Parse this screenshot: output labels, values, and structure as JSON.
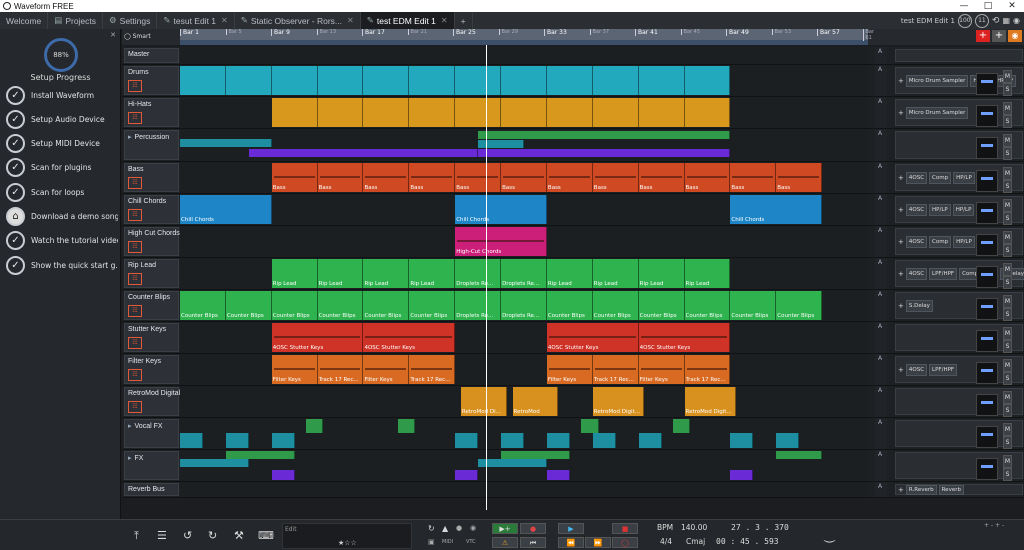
{
  "window": {
    "title": "Waveform FREE"
  },
  "tabs": [
    {
      "label": "Welcome",
      "active": false,
      "closable": false,
      "icon": ""
    },
    {
      "label": "Projects",
      "active": false,
      "closable": false,
      "icon": "folder-icon"
    },
    {
      "label": "Settings",
      "active": false,
      "closable": false,
      "icon": "gear-icon"
    },
    {
      "label": "tesut Edit 1",
      "active": false,
      "closable": true,
      "icon": "edit-icon"
    },
    {
      "label": "Static Observer - Rors...",
      "active": false,
      "closable": true,
      "icon": "edit-icon"
    },
    {
      "label": "test EDM Edit 1",
      "active": true,
      "closable": true,
      "icon": "edit-icon"
    }
  ],
  "header_right": {
    "edit_name": "test EDM Edit 1",
    "cpu": "100",
    "count": "11"
  },
  "setup": {
    "percent": "88%",
    "title": "Setup Progress",
    "steps": [
      {
        "label": "Install Waveform",
        "done": true
      },
      {
        "label": "Setup Audio Device",
        "done": true
      },
      {
        "label": "Setup MIDI Device",
        "done": true
      },
      {
        "label": "Scan for plugins",
        "done": true
      },
      {
        "label": "Scan for loops",
        "done": true
      },
      {
        "label": "Download a demo song",
        "done": false
      },
      {
        "label": "Watch the tutorial video",
        "done": true
      },
      {
        "label": "Show the quick start g...",
        "done": true
      }
    ]
  },
  "timeline": {
    "smart_label": "Smart",
    "markers": [
      "Bar 1",
      "Bar 5",
      "Bar 9",
      "Bar 13",
      "Bar 17",
      "Bar 21",
      "Bar 25",
      "Bar 29",
      "Bar 33",
      "Bar 37",
      "Bar 41",
      "Bar 45",
      "Bar 49",
      "Bar 53",
      "Bar 57",
      "Bar 61"
    ],
    "major": [
      true,
      false,
      true,
      false,
      true,
      false,
      true,
      false,
      true,
      false,
      true,
      false,
      true,
      false,
      true,
      false
    ]
  },
  "tracks": [
    {
      "name": "Master",
      "h": 18,
      "color": "",
      "clips": [],
      "plugins": [],
      "folder": false,
      "icon": false
    },
    {
      "name": "Drums",
      "h": 32,
      "color": "#22a9bd",
      "clips": "drumgrid",
      "plugins": [
        "Micro Drum Sampler",
        "HP/LP",
        "HP/LP"
      ],
      "folder": false,
      "icon": true
    },
    {
      "name": "Hi-Hats",
      "h": 32,
      "color": "#d8981e",
      "clips": "hatgrid",
      "plugins": [
        "Micro Drum Sampler"
      ],
      "folder": false,
      "icon": true
    },
    {
      "name": "Percussion",
      "h": 33,
      "color": "",
      "clips": "perc",
      "plugins": [],
      "folder": true,
      "icon": false
    },
    {
      "name": "Bass",
      "h": 32,
      "color": "#cf4a23",
      "clips": "bass",
      "plugins": [
        "4OSC",
        "Comp",
        "HP/LP"
      ],
      "folder": false,
      "icon": true
    },
    {
      "name": "Chill Chords",
      "h": 32,
      "color": "#1e86c6",
      "clips": "chords",
      "plugins": [
        "4OSC",
        "HP/LP",
        "HP/LP"
      ],
      "folder": false,
      "icon": true
    },
    {
      "name": "High Cut Chords",
      "h": 32,
      "color": "#cc1f7a",
      "clips": "highcut",
      "plugins": [
        "4OSC",
        "Comp",
        "HP/LP"
      ],
      "folder": false,
      "icon": true
    },
    {
      "name": "Rip Lead",
      "h": 32,
      "color": "#2eb34e",
      "clips": "riplead",
      "plugins": [
        "4OSC",
        "LPF/HPF",
        "Compressor",
        "S.Delay"
      ],
      "folder": false,
      "icon": true
    },
    {
      "name": "Counter Blips",
      "h": 32,
      "color": "#2eb34e",
      "clips": "blips",
      "plugins": [
        "S.Delay"
      ],
      "folder": false,
      "icon": true
    },
    {
      "name": "Stutter Keys",
      "h": 32,
      "color": "#cf3226",
      "clips": "stutter",
      "plugins": [],
      "folder": false,
      "icon": true
    },
    {
      "name": "Filter Keys",
      "h": 32,
      "color": "#d86a22",
      "clips": "filter",
      "plugins": [
        "4OSC",
        "LPF/HPF"
      ],
      "folder": false,
      "icon": true
    },
    {
      "name": "RetroMod Digital",
      "h": 32,
      "color": "#d8901e",
      "clips": "retro",
      "plugins": [],
      "folder": false,
      "icon": true
    },
    {
      "name": "Vocal FX",
      "h": 32,
      "color": "",
      "clips": "vocal",
      "plugins": [],
      "folder": true,
      "icon": false
    },
    {
      "name": "FX",
      "h": 32,
      "color": "",
      "clips": "fx",
      "plugins": [],
      "folder": true,
      "icon": false
    },
    {
      "name": "Reverb Bus",
      "h": 16,
      "color": "",
      "clips": [],
      "plugins": [
        "R.Reverb",
        "Reverb"
      ],
      "folder": false,
      "icon": false
    }
  ],
  "clip_labels": {
    "bass": "Bass",
    "chords": "Chill Chords",
    "highcut": "High-Cut Chords",
    "riplead": "Rip Lead",
    "droplets": "Droplets Re...",
    "blips": "Counter Blips",
    "stutter": "4OSC Stutter Keys",
    "filter": "Filter Keys",
    "track17": "Track 17 Rec...",
    "retromod_di": "RetroMod Di...",
    "retromod": "RetroMod",
    "retromod_digit": "RetroMod Digit..."
  },
  "transport": {
    "edit_label": "Edit",
    "bpm_label": "BPM",
    "bpm": "140.00",
    "timesig": "4/4",
    "key": "Cmaj",
    "position": "27 . 3 . 370",
    "time": "00 : 45 . 593",
    "midi_label": "MIDI",
    "vtc_label": "VTC"
  },
  "master_label": "Master"
}
